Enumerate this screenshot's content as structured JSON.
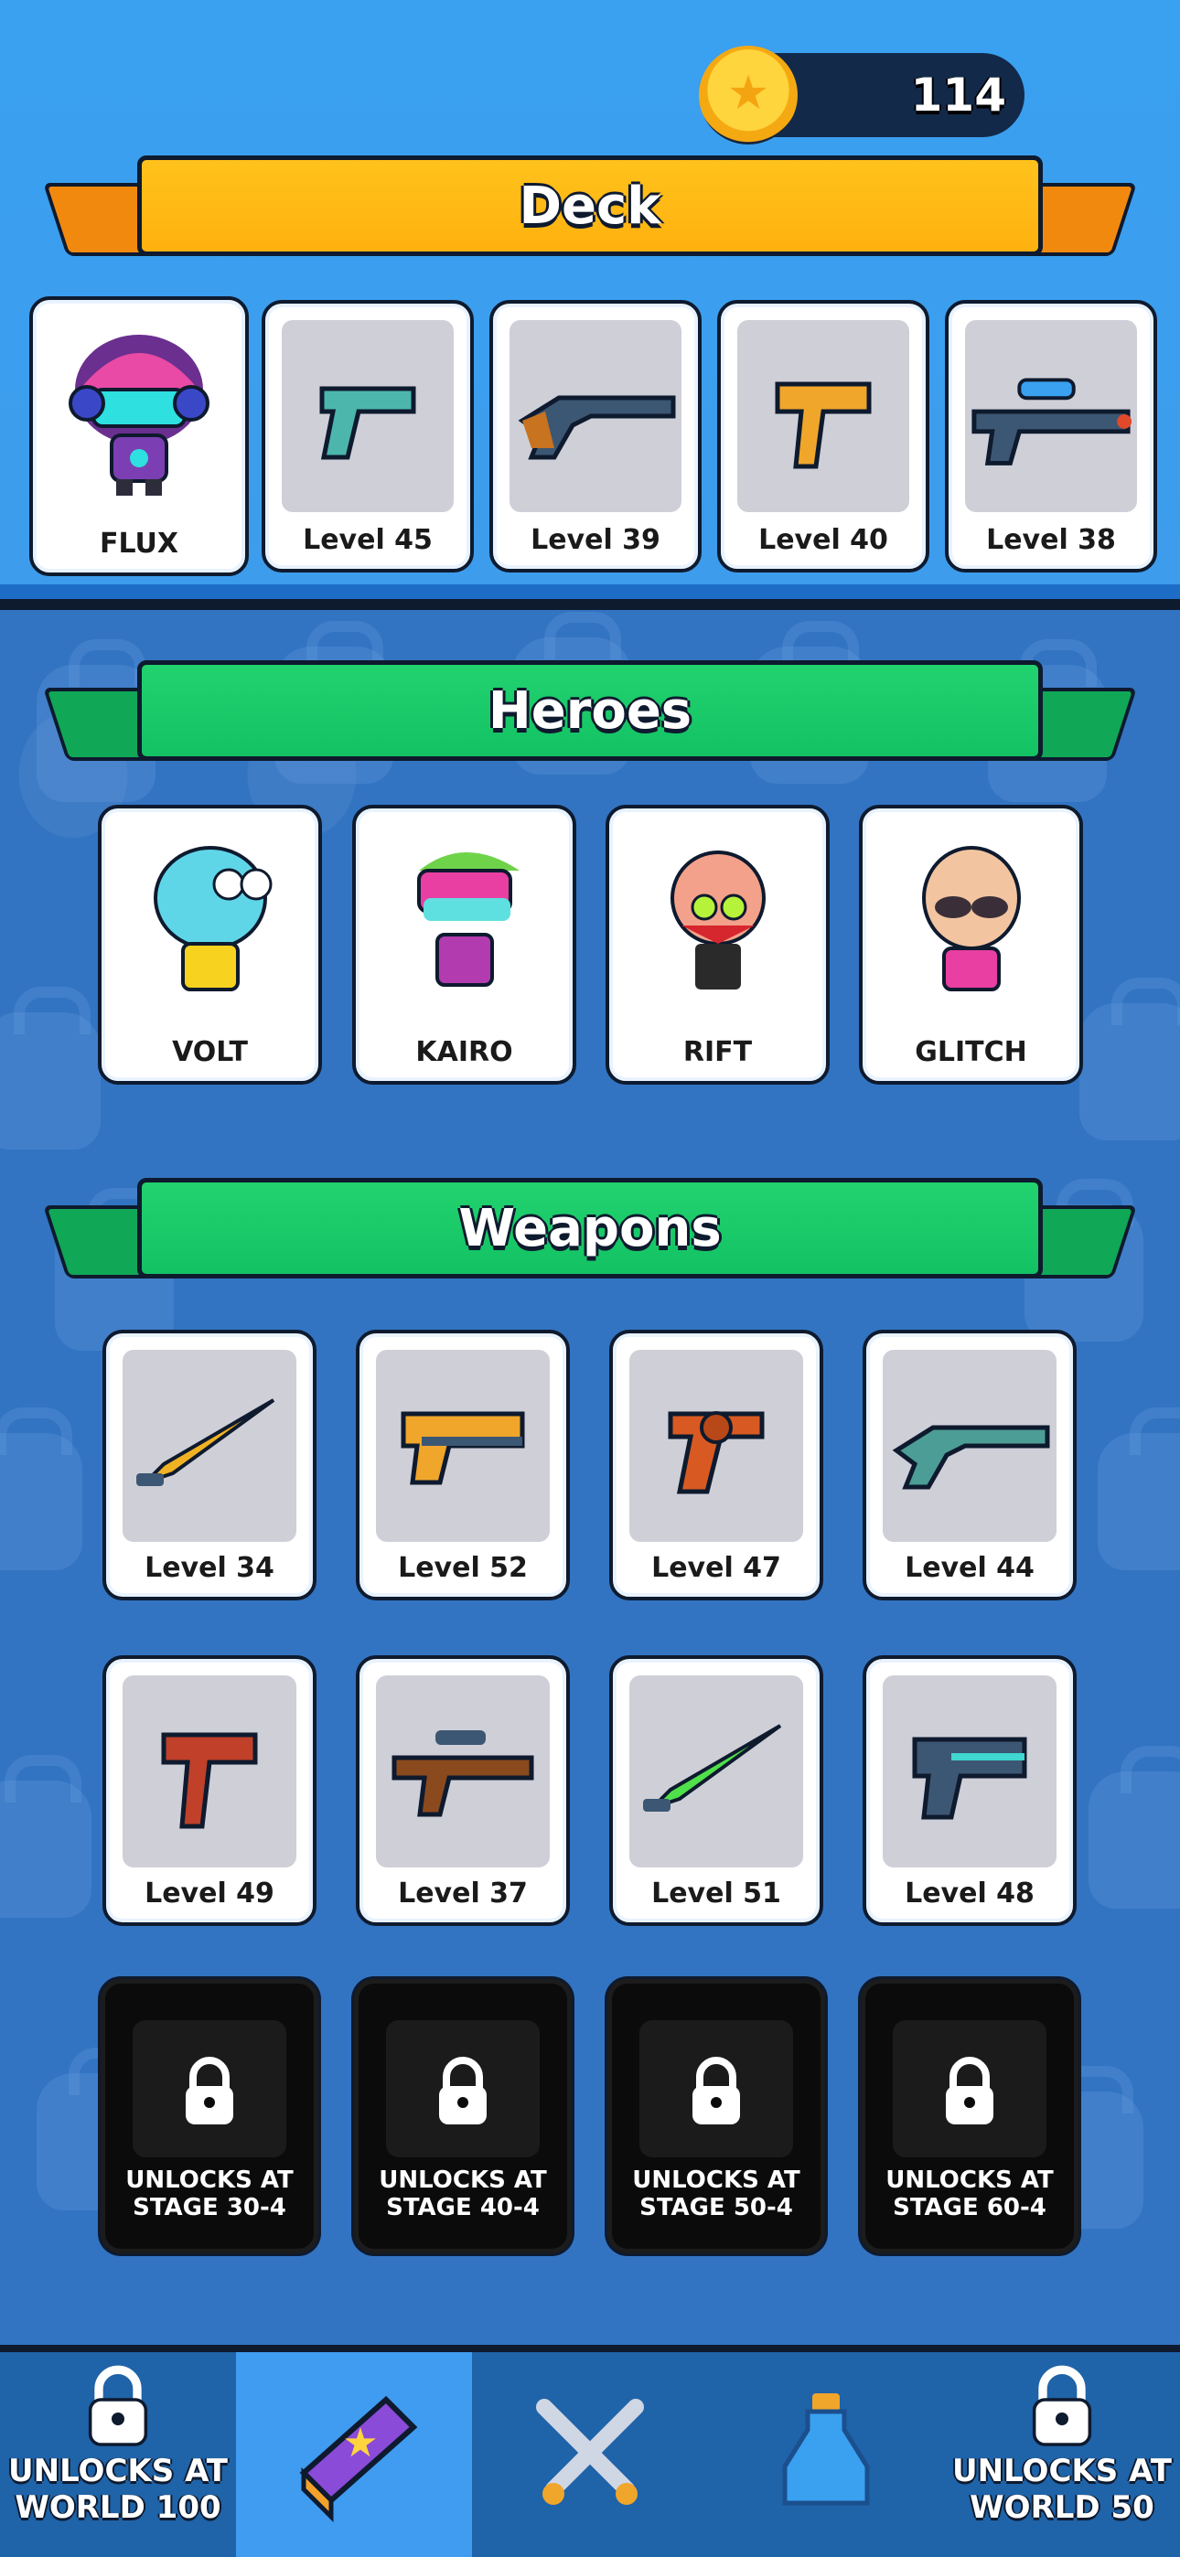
{
  "currency": {
    "coins": "114",
    "icon": "gold-star-coin-icon"
  },
  "deck": {
    "title": "Deck",
    "slots": [
      {
        "label": "FLUX",
        "icon": "hero-flux-icon"
      },
      {
        "label": "Level 45",
        "icon": "pistol-icon"
      },
      {
        "label": "Level 39",
        "icon": "shotgun-icon"
      },
      {
        "label": "Level 40",
        "icon": "smg-icon"
      },
      {
        "label": "Level 38",
        "icon": "sniper-icon"
      }
    ]
  },
  "heroes": {
    "title": "Heroes",
    "items": [
      {
        "label": "VOLT",
        "icon": "hero-volt-icon",
        "color": "#5fd6e8"
      },
      {
        "label": "KAIRO",
        "icon": "hero-kairo-icon",
        "color": "#e93fa3"
      },
      {
        "label": "RIFT",
        "icon": "hero-rift-icon",
        "color": "#f3a18a"
      },
      {
        "label": "GLITCH",
        "icon": "hero-glitch-icon",
        "color": "#f2c4a0"
      }
    ]
  },
  "weapons": {
    "title": "Weapons",
    "items": [
      {
        "label": "Level 34",
        "icon": "gold-sword-icon"
      },
      {
        "label": "Level 52",
        "icon": "blaster-icon"
      },
      {
        "label": "Level 47",
        "icon": "revolver-icon"
      },
      {
        "label": "Level 44",
        "icon": "teal-shotgun-icon"
      },
      {
        "label": "Level 49",
        "icon": "uzi-icon"
      },
      {
        "label": "Level 37",
        "icon": "assault-rifle-icon"
      },
      {
        "label": "Level 51",
        "icon": "green-sword-icon"
      },
      {
        "label": "Level 48",
        "icon": "plasma-gun-icon"
      }
    ],
    "locked": [
      {
        "text": "UNLOCKS AT\nSTAGE 30-4"
      },
      {
        "text": "UNLOCKS AT\nSTAGE 40-4"
      },
      {
        "text": "UNLOCKS AT\nSTAGE 50-4"
      },
      {
        "text": "UNLOCKS AT\nSTAGE 60-4"
      }
    ]
  },
  "nav": {
    "items": [
      {
        "name": "nav-locked-left",
        "text": "UNLOCKS AT\nWORLD 100",
        "icon": "lock-icon"
      },
      {
        "name": "nav-collection",
        "text": "",
        "icon": "book-icon"
      },
      {
        "name": "nav-battle",
        "text": "",
        "icon": "crossed-swords-icon"
      },
      {
        "name": "nav-potion",
        "text": "",
        "icon": "potion-icon"
      },
      {
        "name": "nav-locked-right",
        "text": "UNLOCKS AT\nWORLD 50",
        "icon": "lock-icon"
      }
    ],
    "active_index": 1
  }
}
